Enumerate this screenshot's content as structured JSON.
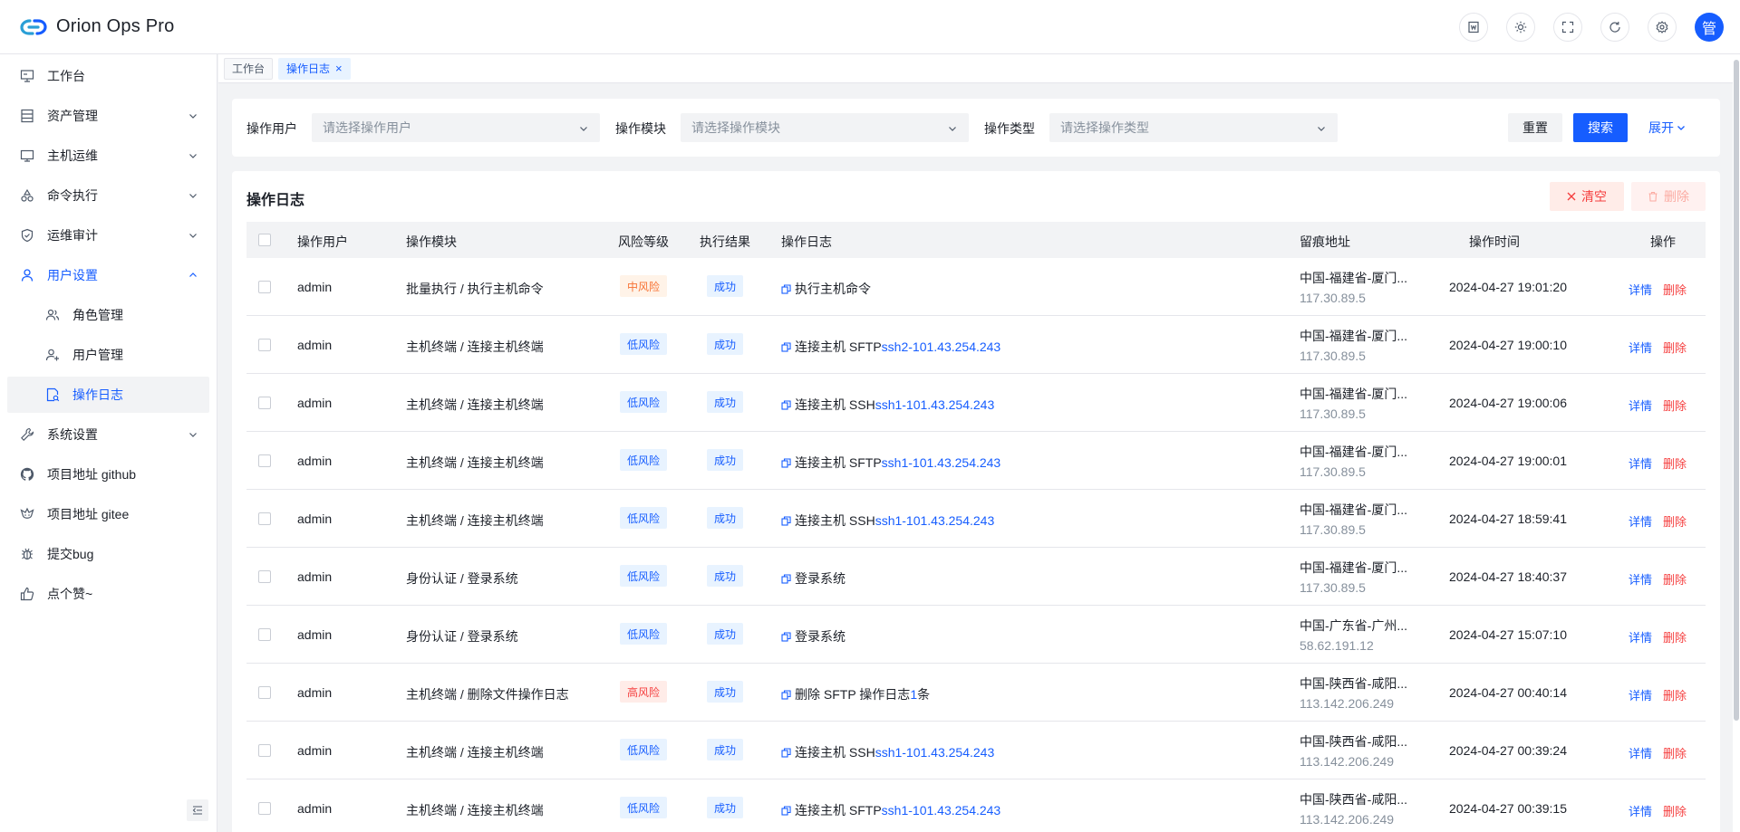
{
  "app": {
    "title": "Orion Ops Pro"
  },
  "header": {
    "avatar_text": "管"
  },
  "sidebar": {
    "items": [
      {
        "label": "工作台"
      },
      {
        "label": "资产管理"
      },
      {
        "label": "主机运维"
      },
      {
        "label": "命令执行"
      },
      {
        "label": "运维审计"
      },
      {
        "label": "用户设置"
      },
      {
        "label": "角色管理"
      },
      {
        "label": "用户管理"
      },
      {
        "label": "操作日志"
      },
      {
        "label": "系统设置"
      },
      {
        "label": "项目地址 github"
      },
      {
        "label": "项目地址 gitee"
      },
      {
        "label": "提交bug"
      },
      {
        "label": "点个赞~"
      }
    ]
  },
  "tabs": [
    {
      "label": "工作台"
    },
    {
      "label": "操作日志",
      "close": "×"
    }
  ],
  "query": {
    "user_label": "操作用户",
    "user_placeholder": "请选择操作用户",
    "module_label": "操作模块",
    "module_placeholder": "请选择操作模块",
    "type_label": "操作类型",
    "type_placeholder": "请选择操作类型",
    "reset": "重置",
    "search": "搜索",
    "expand": "展开"
  },
  "table": {
    "title": "操作日志",
    "clear": "清空",
    "delete": "删除",
    "columns": [
      "操作用户",
      "操作模块",
      "风险等级",
      "执行结果",
      "操作日志",
      "留痕地址",
      "操作时间",
      "操作"
    ],
    "detail": "详情",
    "row_delete": "删除",
    "rows": [
      {
        "user": "admin",
        "module": "批量执行 / 执行主机命令",
        "risk": "中风险",
        "risk_level": "mid",
        "result": "成功",
        "log_text": "执行主机命令",
        "log_link": "",
        "log_suffix": "",
        "loc": "中国-福建省-厦门...",
        "ip": "117.30.89.5",
        "time": "2024-04-27 19:01:20"
      },
      {
        "user": "admin",
        "module": "主机终端 / 连接主机终端",
        "risk": "低风险",
        "risk_level": "low",
        "result": "成功",
        "log_text": "连接主机 SFTP ",
        "log_link": "ssh2-101.43.254.243",
        "log_suffix": "",
        "loc": "中国-福建省-厦门...",
        "ip": "117.30.89.5",
        "time": "2024-04-27 19:00:10"
      },
      {
        "user": "admin",
        "module": "主机终端 / 连接主机终端",
        "risk": "低风险",
        "risk_level": "low",
        "result": "成功",
        "log_text": "连接主机 SSH ",
        "log_link": "ssh1-101.43.254.243",
        "log_suffix": "",
        "loc": "中国-福建省-厦门...",
        "ip": "117.30.89.5",
        "time": "2024-04-27 19:00:06"
      },
      {
        "user": "admin",
        "module": "主机终端 / 连接主机终端",
        "risk": "低风险",
        "risk_level": "low",
        "result": "成功",
        "log_text": "连接主机 SFTP ",
        "log_link": "ssh1-101.43.254.243",
        "log_suffix": "",
        "loc": "中国-福建省-厦门...",
        "ip": "117.30.89.5",
        "time": "2024-04-27 19:00:01"
      },
      {
        "user": "admin",
        "module": "主机终端 / 连接主机终端",
        "risk": "低风险",
        "risk_level": "low",
        "result": "成功",
        "log_text": "连接主机 SSH ",
        "log_link": "ssh1-101.43.254.243",
        "log_suffix": "",
        "loc": "中国-福建省-厦门...",
        "ip": "117.30.89.5",
        "time": "2024-04-27 18:59:41"
      },
      {
        "user": "admin",
        "module": "身份认证 / 登录系统",
        "risk": "低风险",
        "risk_level": "low",
        "result": "成功",
        "log_text": "登录系统",
        "log_link": "",
        "log_suffix": "",
        "loc": "中国-福建省-厦门...",
        "ip": "117.30.89.5",
        "time": "2024-04-27 18:40:37"
      },
      {
        "user": "admin",
        "module": "身份认证 / 登录系统",
        "risk": "低风险",
        "risk_level": "low",
        "result": "成功",
        "log_text": "登录系统",
        "log_link": "",
        "log_suffix": "",
        "loc": "中国-广东省-广州...",
        "ip": "58.62.191.12",
        "time": "2024-04-27 15:07:10"
      },
      {
        "user": "admin",
        "module": "主机终端 / 删除文件操作日志",
        "risk": "高风险",
        "risk_level": "high",
        "result": "成功",
        "log_text": "删除 SFTP 操作日志 ",
        "log_link": "1",
        "log_suffix": " 条",
        "loc": "中国-陕西省-咸阳...",
        "ip": "113.142.206.249",
        "time": "2024-04-27 00:40:14"
      },
      {
        "user": "admin",
        "module": "主机终端 / 连接主机终端",
        "risk": "低风险",
        "risk_level": "low",
        "result": "成功",
        "log_text": "连接主机 SSH ",
        "log_link": "ssh1-101.43.254.243",
        "log_suffix": "",
        "loc": "中国-陕西省-咸阳...",
        "ip": "113.142.206.249",
        "time": "2024-04-27 00:39:24"
      },
      {
        "user": "admin",
        "module": "主机终端 / 连接主机终端",
        "risk": "低风险",
        "risk_level": "low",
        "result": "成功",
        "log_text": "连接主机 SFTP ",
        "log_link": "ssh1-101.43.254.243",
        "log_suffix": "",
        "loc": "中国-陕西省-咸阳...",
        "ip": "113.142.206.249",
        "time": "2024-04-27 00:39:15"
      }
    ]
  },
  "colors": {
    "primary": "#165dff",
    "danger": "#f53f3f",
    "warning": "#f77234"
  }
}
